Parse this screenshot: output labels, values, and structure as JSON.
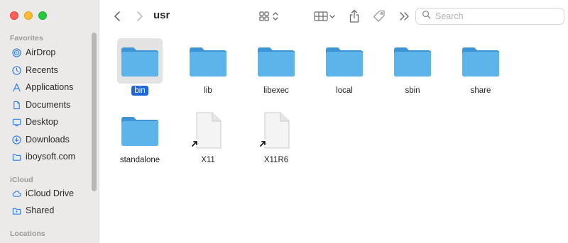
{
  "window": {
    "title": "usr",
    "traffic_lights": {
      "close": "#fe5f57",
      "minimize": "#febc2e",
      "maximize": "#28c840"
    }
  },
  "sidebar": {
    "sections": [
      {
        "heading": "Favorites",
        "items": [
          {
            "label": "AirDrop",
            "icon": "airdrop-icon"
          },
          {
            "label": "Recents",
            "icon": "clock-icon"
          },
          {
            "label": "Applications",
            "icon": "applications-icon"
          },
          {
            "label": "Documents",
            "icon": "document-icon"
          },
          {
            "label": "Desktop",
            "icon": "desktop-icon"
          },
          {
            "label": "Downloads",
            "icon": "download-icon"
          },
          {
            "label": "iboysoft.com",
            "icon": "folder-icon"
          }
        ]
      },
      {
        "heading": "iCloud",
        "items": [
          {
            "label": "iCloud Drive",
            "icon": "cloud-icon"
          },
          {
            "label": "Shared",
            "icon": "shared-folder-icon"
          }
        ]
      },
      {
        "heading": "Locations",
        "items": []
      }
    ]
  },
  "toolbar": {
    "back_icon": "chevron-left-icon",
    "forward_icon": "chevron-right-icon",
    "view_icon": "grid-view-icon",
    "group_icon": "group-icon",
    "share_icon": "share-icon",
    "tag_icon": "tag-icon",
    "more_icon": "double-chevron-icon",
    "search": {
      "placeholder": "Search",
      "value": ""
    }
  },
  "files": [
    {
      "name": "bin",
      "kind": "folder",
      "selected": true
    },
    {
      "name": "lib",
      "kind": "folder",
      "selected": false
    },
    {
      "name": "libexec",
      "kind": "folder",
      "selected": false
    },
    {
      "name": "local",
      "kind": "folder",
      "selected": false
    },
    {
      "name": "sbin",
      "kind": "folder",
      "selected": false
    },
    {
      "name": "share",
      "kind": "folder",
      "selected": false
    },
    {
      "name": "standalone",
      "kind": "folder",
      "selected": false
    },
    {
      "name": "X11",
      "kind": "alias",
      "selected": false
    },
    {
      "name": "X11R6",
      "kind": "alias",
      "selected": false
    }
  ],
  "colors": {
    "accent": "#1f66d8",
    "folder": "#5cb4ea",
    "sidebar_icon": "#2f7de1"
  }
}
